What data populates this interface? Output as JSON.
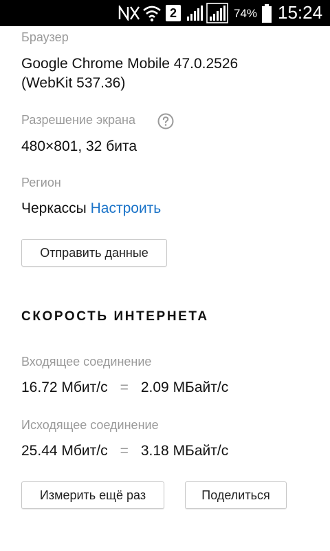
{
  "status_bar": {
    "battery_percent": "74%",
    "time": "15:24",
    "sim_badge": "2",
    "icons": [
      "signal-muted-icon",
      "wifi-icon",
      "sim2-icon",
      "signal-icon",
      "signal-icon",
      "battery-icon"
    ]
  },
  "device": {
    "browser_label": "Браузер",
    "browser_value_line1": "Google Chrome Mobile 47.0.2526",
    "browser_value_line2": "(WebKit 537.36)",
    "resolution_label": "Разрешение экрана",
    "resolution_value": "480×801, 32 бита",
    "region_label": "Регион",
    "region_city": "Черкассы",
    "region_configure_link": "Настроить",
    "send_data_button": "Отправить данные"
  },
  "speed": {
    "section_title": "СКОРОСТЬ ИНТЕРНЕТА",
    "incoming_label": "Входящее соединение",
    "incoming_mbit": "16.72 Мбит/с",
    "incoming_mbyte": "2.09 МБайт/с",
    "outgoing_label": "Исходящее соединение",
    "outgoing_mbit": "25.44 Мбит/с",
    "outgoing_mbyte": "3.18 МБайт/с",
    "equals_sign": "=",
    "measure_again_button": "Измерить ещё раз",
    "share_button": "Поделиться"
  },
  "colors": {
    "link": "#1a73c8",
    "label_gray": "#9a9a9a",
    "status_bar_bg": "#000000"
  }
}
